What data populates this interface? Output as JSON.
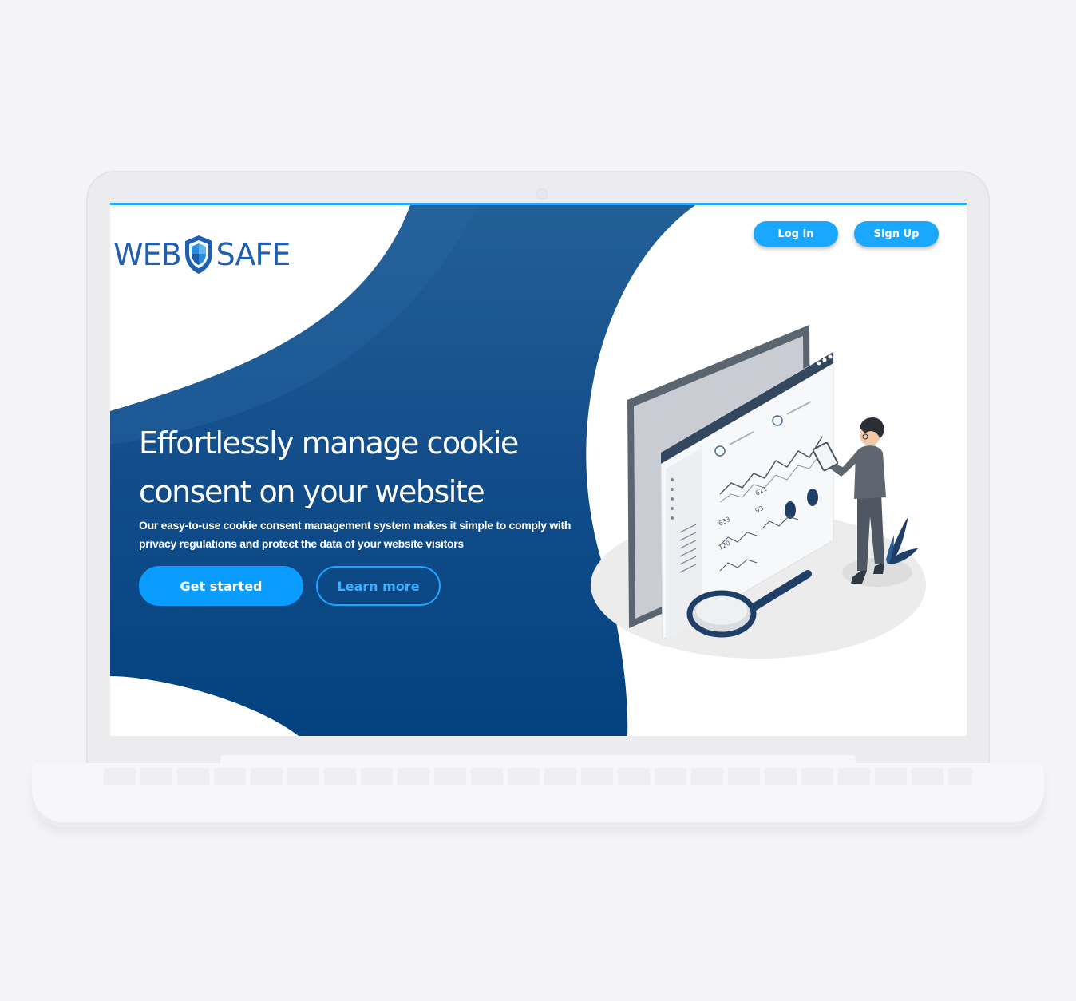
{
  "brand": {
    "name_left": "WEB",
    "name_right": "SAFE"
  },
  "nav": {
    "login_label": "Log In",
    "signup_label": "Sign Up"
  },
  "hero": {
    "headline": "Effortlessly manage cookie consent on your website",
    "subtext": "Our easy-to-use cookie consent management system makes it simple to comply with privacy regulations and protect the data of your website visitors",
    "primary_cta": "Get started",
    "secondary_cta": "Learn more"
  },
  "illustration": {
    "chart_labels": [
      "621",
      "633",
      "93",
      "120"
    ]
  },
  "colors": {
    "brand_blue": "#1e5fb0",
    "hero_navy": "#0d4a8a",
    "accent": "#1aa7ff",
    "background": "#f4f4f6"
  }
}
